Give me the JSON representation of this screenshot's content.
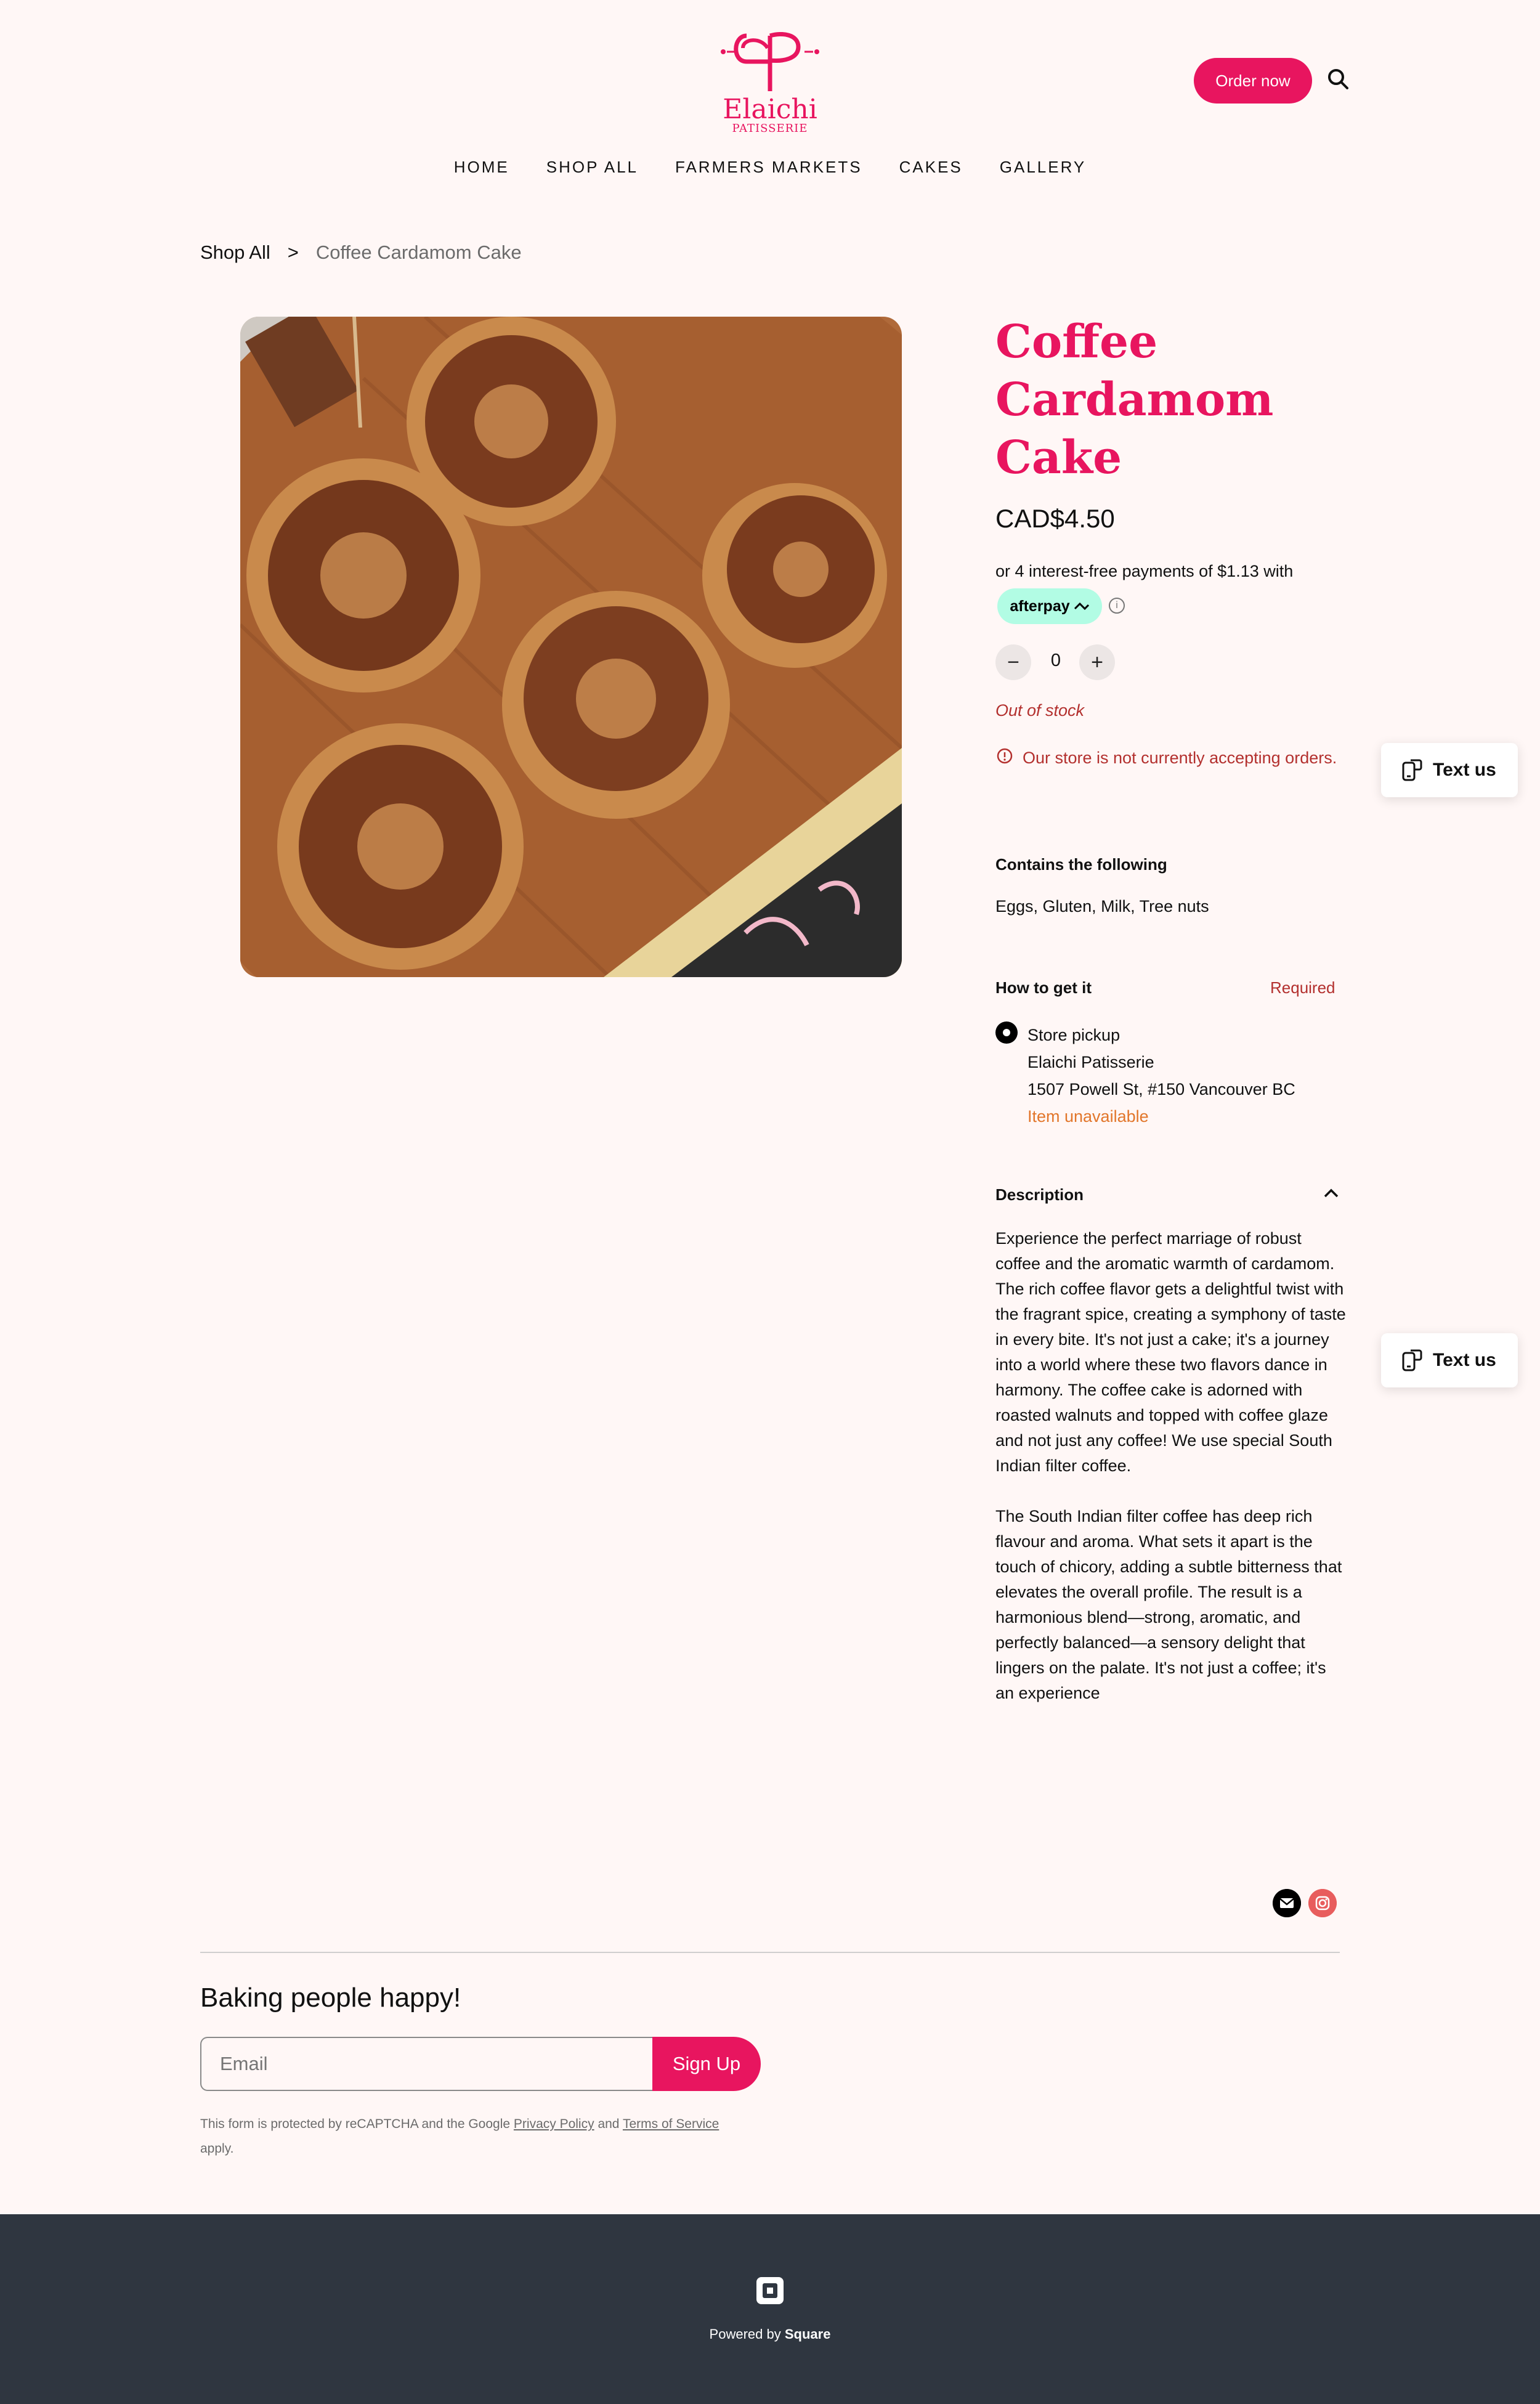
{
  "brand": {
    "name": "Elaichi",
    "sub": "PATISSERIE",
    "accent": "#e8155f"
  },
  "header": {
    "order_now": "Order now"
  },
  "nav": [
    "HOME",
    "SHOP ALL",
    "FARMERS MARKETS",
    "CAKES",
    "GALLERY"
  ],
  "breadcrumb": {
    "parent": "Shop All",
    "sep": ">",
    "current": "Coffee Cardamom Cake"
  },
  "product": {
    "title": "Coffee Cardamom Cake",
    "price": "CAD$4.50",
    "afterpay_text": "or 4 interest-free payments of $1.13 with",
    "afterpay_label": "afterpay",
    "quantity": "0",
    "stock": "Out of stock",
    "warning": "Our store is not currently accepting orders."
  },
  "contains": {
    "heading": "Contains the following",
    "value": "Eggs, Gluten, Milk, Tree nuts"
  },
  "fulfillment": {
    "heading": "How to get it",
    "required": "Required",
    "option": "Store pickup",
    "store": "Elaichi Patisserie",
    "address": "1507 Powell St, #150 Vancouver BC",
    "status": "Item unavailable"
  },
  "description": {
    "heading": "Description",
    "p1": "Experience the perfect marriage of robust coffee and the aromatic warmth of cardamom. The rich coffee flavor gets a delightful twist with the fragrant spice, creating a symphony of taste in every bite. It's not just a cake; it's a journey into a world where these two flavors dance in harmony. The coffee cake is adorned with roasted walnuts and topped with coffee glaze and not just any coffee! We use special South Indian filter coffee.",
    "p2": "The South Indian filter coffee has deep rich flavour and aroma. What sets it apart is the touch of chicory, adding a subtle bitterness that elevates the overall profile. The result is a harmonious blend—strong, aromatic, and perfectly balanced—a sensory delight that lingers on the palate. It's not just a coffee; it's an experience"
  },
  "text_us": "Text us",
  "newsletter": {
    "tagline": "Baking people happy!",
    "email_placeholder": "Email",
    "signup": "Sign Up",
    "recaptcha_pre": "This form is protected by reCAPTCHA and the Google ",
    "privacy": "Privacy Policy",
    "and": " and ",
    "terms": "Terms of Service",
    "apply": " apply."
  },
  "footer": {
    "powered_by": "Powered by ",
    "brand": "Square"
  }
}
